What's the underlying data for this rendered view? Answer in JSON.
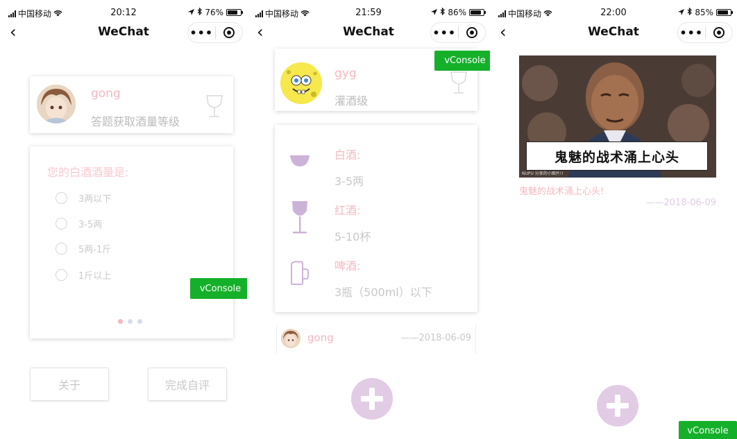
{
  "screens": [
    {
      "status": {
        "carrier": "中国移动",
        "time": "20:12",
        "battery": "76%",
        "battery_level": 0.76
      },
      "nav": {
        "title": "WeChat"
      },
      "profile": {
        "name": "gong",
        "subtitle": "答题获取酒量等级"
      },
      "quiz": {
        "question": "您的白酒酒量是:",
        "options": [
          "3两以下",
          "3-5两",
          "5两-1斤",
          "1斤以上"
        ]
      },
      "buttons": {
        "about": "关于",
        "finish": "完成自评"
      },
      "vconsole": "vConsole"
    },
    {
      "status": {
        "carrier": "中国移动",
        "time": "21:59",
        "battery": "86%",
        "battery_level": 0.86
      },
      "nav": {
        "title": "WeChat"
      },
      "profile": {
        "name": "gyg",
        "subtitle": "灌酒级"
      },
      "drinks": [
        {
          "label": "白酒:",
          "amount": "3-5两",
          "icon": "baijiu-cup-icon"
        },
        {
          "label": "红酒:",
          "amount": "5-10杯",
          "icon": "wine-glass-icon"
        },
        {
          "label": "啤酒:",
          "amount": "3瓶（500ml）以下",
          "icon": "beer-mug-icon"
        }
      ],
      "record": {
        "name": "gong",
        "date": "——2018-06-09"
      },
      "vconsole": "vConsole"
    },
    {
      "status": {
        "carrier": "中国移动",
        "time": "22:00",
        "battery": "85%",
        "battery_level": 0.85
      },
      "nav": {
        "title": "WeChat"
      },
      "post": {
        "image_caption": "鬼魅的战术涌上心头",
        "image_watermark": "NUPU 分享的小图片!!",
        "text": "鬼魅的战术涌上心头!",
        "date": "——2018-06-09"
      },
      "vconsole": "vConsole"
    }
  ],
  "colors": {
    "accent_pink": "#f4b8c0",
    "accent_purple": "#e2cbe5",
    "vconsole_green": "#15b02a"
  }
}
